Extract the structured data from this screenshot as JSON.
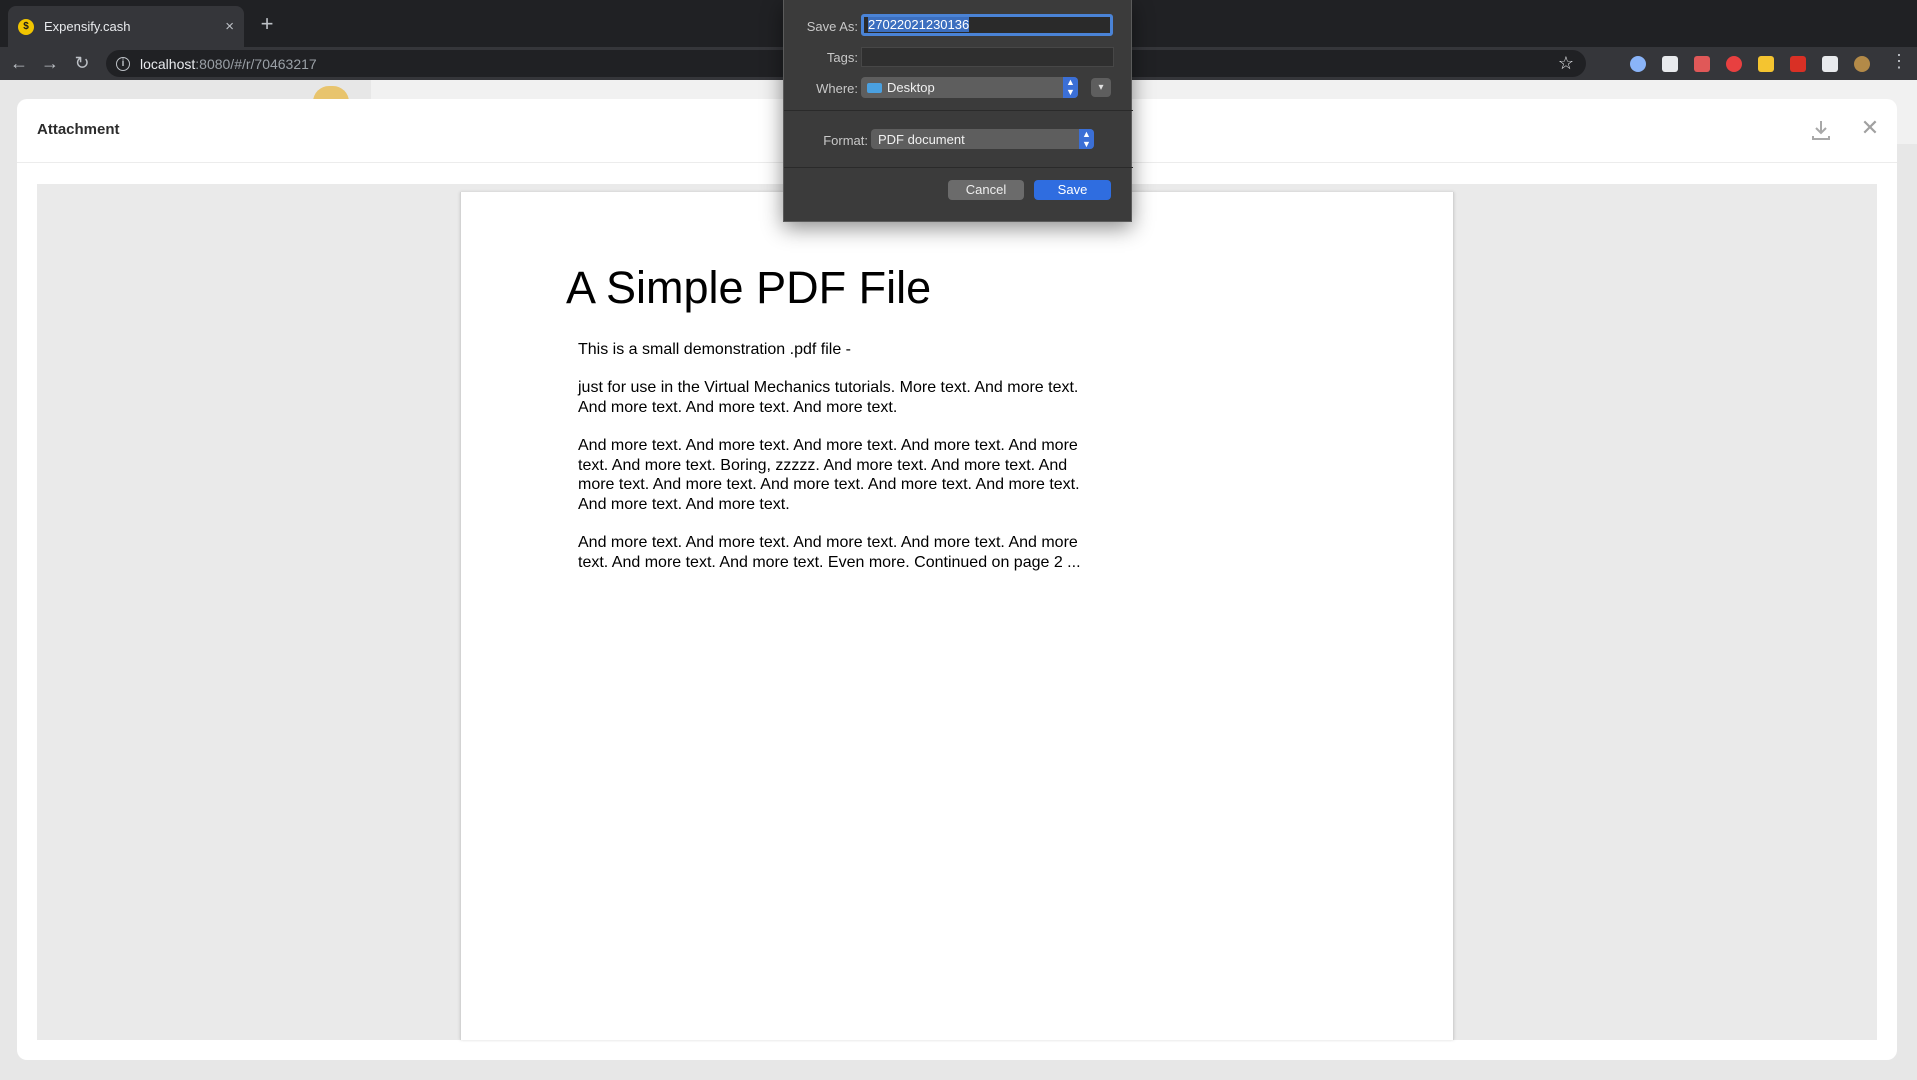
{
  "browser": {
    "tab": {
      "title": "Expensify.cash",
      "favicon_letter": "$",
      "close": "×"
    },
    "new_tab": "+",
    "url": {
      "host": "localhost",
      "path": ":8080/#/r/70463217"
    },
    "nav": {
      "back": "←",
      "forward": "→",
      "reload": "↻"
    },
    "star": "☆",
    "menu": "⋮",
    "extension_colors": [
      "#8ab4f8",
      "#e8eaed",
      "#e05858",
      "#e84040",
      "#f4c430",
      "#d93025",
      "#e8eaed",
      "#b38a48"
    ]
  },
  "modal": {
    "title": "Attachment",
    "close": "✕"
  },
  "pdf": {
    "title": "A Simple PDF File",
    "paragraphs": [
      "This is a small demonstration .pdf file -",
      "just for use in the Virtual Mechanics tutorials. More text. And more text. And more text. And more text. And more text.",
      "And more text. And more text. And more text. And more text. And more text. And more text. Boring, zzzzz. And more text. And more text. And more text. And more text. And more text. And more text. And more text. And more text. And more text.",
      "And more text. And more text. And more text. And more text. And more text. And more text. And more text. Even more. Continued on page 2 ..."
    ]
  },
  "save_dialog": {
    "save_as_label": "Save As:",
    "save_as_value": "27022021230136",
    "tags_label": "Tags:",
    "where_label": "Where:",
    "where_value": "Desktop",
    "format_label": "Format:",
    "format_value": "PDF document",
    "cancel_label": "Cancel",
    "save_label": "Save"
  }
}
